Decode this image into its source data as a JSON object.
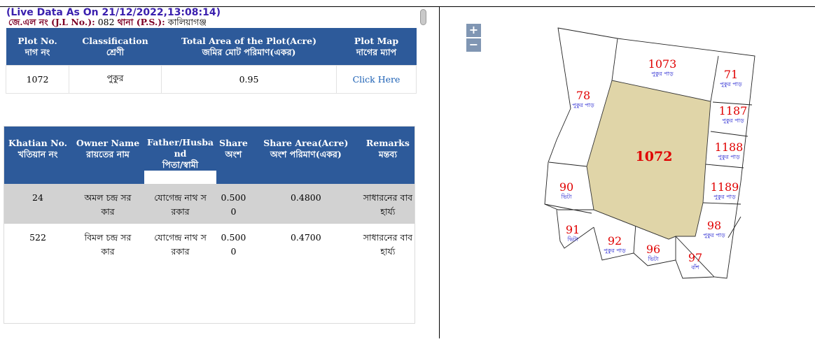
{
  "header": {
    "live_data": "(Live Data As On 21/12/2022,13:08:14)",
    "jl_label": "জে.এল নং (J.L No.):",
    "jl_value": " 082 ",
    "ps_label": "থানা (P.S.):",
    "ps_value": " কালিয়াগঞ্জ"
  },
  "plot_table": {
    "headers": [
      {
        "en": "Plot No.",
        "bn": "দাগ নং"
      },
      {
        "en": "Classification",
        "bn": "শ্রেণী"
      },
      {
        "en": "Total Area of the Plot(Acre)",
        "bn": "জমির মোট পরিমাণ(একর)"
      },
      {
        "en": "Plot Map",
        "bn": "দাগের ম্যাপ"
      }
    ],
    "row": {
      "plot_no": "1072",
      "classification": "পুকুর",
      "area": "0.95",
      "map_link": "Click Here"
    }
  },
  "owner_table": {
    "headers": [
      {
        "en": "Khatian No.",
        "bn": "খতিয়ান নং"
      },
      {
        "en": "Owner Name",
        "bn": "রায়তের নাম"
      },
      {
        "en": "Father/Husba",
        "en2": "nd",
        "bn": "পিতা/স্বামী"
      },
      {
        "en": "Share",
        "bn": "অংশ"
      },
      {
        "en": "Share Area(Acre)",
        "bn": "অংশ পরিমাণ(একর)"
      },
      {
        "en": "Remarks",
        "bn": "মন্তব্য"
      }
    ],
    "rows": [
      {
        "khatian": "24",
        "owner_1": "অমল চন্দ্র সর",
        "owner_2": "কার",
        "father_1": "যোগেন্দ্র নাথ স",
        "father_2": "রকার",
        "share_1": "0.500",
        "share_2": "0",
        "share_area": "0.4800",
        "remarks_1": "সাধারনের বাব",
        "remarks_2": "হার্য্য"
      },
      {
        "khatian": "522",
        "owner_1": "বিমল চন্দ্র সর",
        "owner_2": "কার",
        "father_1": "যোগেন্দ্র নাথ স",
        "father_2": "রকার",
        "share_1": "0.500",
        "share_2": "0",
        "share_area": "0.4700",
        "remarks_1": "সাধারনের বাব",
        "remarks_2": "হার্য্য"
      }
    ]
  },
  "map": {
    "zoom_in": "+",
    "zoom_out": "−",
    "selected_plot": "1072",
    "selected_fill": "#e0d5a8",
    "plots": [
      {
        "no": "1073",
        "use": "পুকুর পাড়"
      },
      {
        "no": "71",
        "use": "পুকুর পাড়"
      },
      {
        "no": "78",
        "use": "পুকুর পাড়"
      },
      {
        "no": "1187",
        "use": "পুকুর পাড়"
      },
      {
        "no": "1188",
        "use": "পুকুর পাড়"
      },
      {
        "no": "1189",
        "use": "পুকুর পাড়"
      },
      {
        "no": "90",
        "use": "ভিটা"
      },
      {
        "no": "91",
        "use": "ভিটা"
      },
      {
        "no": "92",
        "use": "পুকুর পাড়"
      },
      {
        "no": "96",
        "use": "ভিটা"
      },
      {
        "no": "98",
        "use": "পুকুর পাড়"
      },
      {
        "no": "97",
        "use": "বাঁশ"
      }
    ]
  }
}
